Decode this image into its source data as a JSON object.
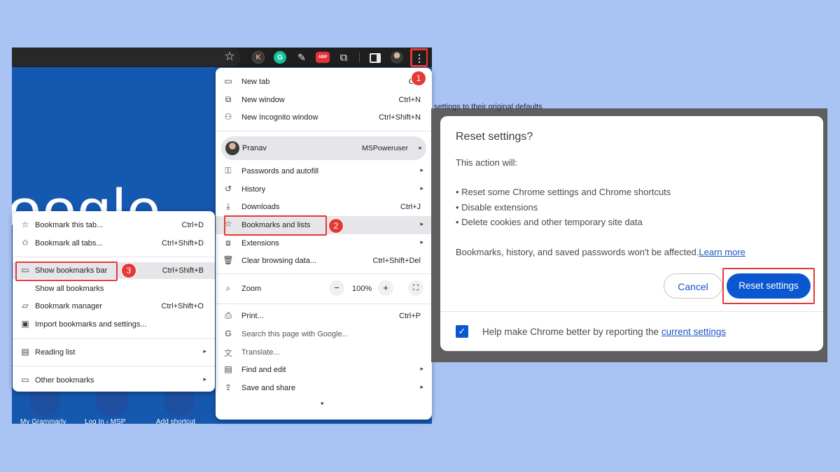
{
  "icons": {
    "star": "☆",
    "ext_k": "K",
    "ext_g": "G",
    "ext_pen": "✎",
    "ext_abp": "ABP",
    "ext_puzzle": "⧉",
    "kebab": "⋮",
    "plus": "+",
    "checkmark": "✓"
  },
  "page": {
    "logo_text": "oogle"
  },
  "shortcuts": [
    {
      "label": "My Grammarly"
    },
    {
      "label": "Log In ‹ MSP"
    },
    {
      "label": "Add shortcut"
    }
  ],
  "main_menu": {
    "items": [
      {
        "icon": "new-tab-icon",
        "label": "New tab",
        "shortcut": "Ctrl"
      },
      {
        "icon": "new-window-icon",
        "label": "New window",
        "shortcut": "Ctrl+N"
      },
      {
        "icon": "incognito-icon",
        "label": "New Incognito window",
        "shortcut": "Ctrl+Shift+N"
      },
      {
        "icon": "profile-avatar",
        "label": "Pranav",
        "shortcut": "MSPoweruser"
      },
      {
        "icon": "key-icon",
        "label": "Passwords and autofill"
      },
      {
        "icon": "history-icon",
        "label": "History"
      },
      {
        "icon": "download-icon",
        "label": "Downloads",
        "shortcut": "Ctrl+J"
      },
      {
        "icon": "star-icon",
        "label": "Bookmarks and lists"
      },
      {
        "icon": "extensions-icon",
        "label": "Extensions"
      },
      {
        "icon": "trash-icon",
        "label": "Clear browsing data...",
        "shortcut": "Ctrl+Shift+Del"
      },
      {
        "icon": "zoom-icon",
        "label": "Zoom"
      },
      {
        "icon": "print-icon",
        "label": "Print...",
        "shortcut": "Ctrl+P"
      },
      {
        "icon": "google-icon",
        "label": "Search this page with Google..."
      },
      {
        "icon": "translate-icon",
        "label": "Translate..."
      },
      {
        "icon": "find-icon",
        "label": "Find and edit"
      },
      {
        "icon": "share-icon",
        "label": "Save and share"
      }
    ],
    "zoom": {
      "minus": "−",
      "value": "100%",
      "plus": "+",
      "fullscreen": "⛶"
    },
    "more": "▾"
  },
  "bookmarks_menu": {
    "items": [
      {
        "icon": "star-add-icon",
        "label": "Bookmark this tab...",
        "shortcut": "Ctrl+D"
      },
      {
        "icon": "star-all-icon",
        "label": "Bookmark all tabs...",
        "shortcut": "Ctrl+Shift+D"
      },
      {
        "icon": "bookmarks-bar-icon",
        "label": "Show bookmarks bar",
        "shortcut": "Ctrl+Shift+B"
      },
      {
        "icon": "none",
        "label": "Show all bookmarks"
      },
      {
        "icon": "bookmark-manager-icon",
        "label": "Bookmark manager",
        "shortcut": "Ctrl+Shift+O"
      },
      {
        "icon": "import-icon",
        "label": "Import bookmarks and settings..."
      },
      {
        "icon": "reading-list-icon",
        "label": "Reading list"
      },
      {
        "icon": "folder-icon",
        "label": "Other bookmarks"
      }
    ]
  },
  "badges": {
    "one": "1",
    "two": "2",
    "three": "3"
  },
  "dialog": {
    "background_text": "settings to their original defaults",
    "title": "Reset settings?",
    "intro": "This action will:",
    "bullets": [
      "• Reset some Chrome settings and Chrome shortcuts",
      "• Disable extensions",
      "• Delete cookies and other temporary site data"
    ],
    "note": "Bookmarks, history, and saved passwords won't be affected.",
    "learn_more": "Learn more",
    "cancel": "Cancel",
    "reset": "Reset settings",
    "help_text": "Help make Chrome better by reporting the ",
    "help_link": "current settings",
    "checkbox_checked": true
  },
  "colors": {
    "accent": "#0b57d0",
    "highlight": "#e53935",
    "background": "#a9c3f5"
  }
}
